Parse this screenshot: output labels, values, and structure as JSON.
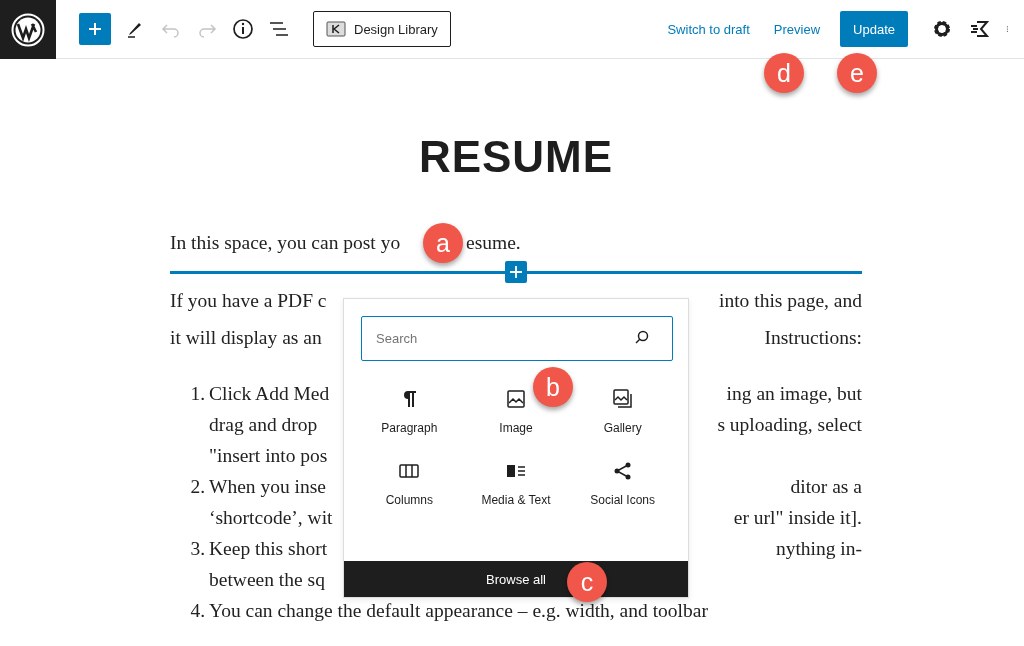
{
  "toolbar": {
    "undo_disabled": true,
    "redo_disabled": true,
    "design_library": "Design Library",
    "switch_to_draft": "Switch to draft",
    "preview": "Preview",
    "update": "Update"
  },
  "title": "RESUME",
  "intro": {
    "left": "In this space, you can post yo",
    "right": "esume."
  },
  "paragraph_lines": [
    {
      "left": "If you have a PDF c",
      "right": "into this page, and"
    },
    {
      "left": "it will display as an",
      "right": "Instructions:"
    }
  ],
  "list": [
    {
      "number": "1.",
      "lines": [
        {
          "left": "Click Add Med",
          "right": "ing an image, but"
        },
        {
          "left": "drag and drop",
          "right": "s uploading, select"
        },
        {
          "left": "\"insert into pos"
        }
      ]
    },
    {
      "number": "2.",
      "lines": [
        {
          "left": "When you inse",
          "right": "ditor as a"
        },
        {
          "left": "‘shortcode’, wit",
          "right": "er url\" inside it]."
        }
      ]
    },
    {
      "number": "3.",
      "lines": [
        {
          "left": "Keep this short",
          "right": "nything in-"
        },
        {
          "left": "between the sq"
        }
      ]
    },
    {
      "number": "4.",
      "lines": [
        {
          "left": "You can change the default appearance – e.g. width, and toolbar"
        }
      ]
    }
  ],
  "inserter": {
    "search": {
      "placeholder": "Search"
    },
    "blocks": [
      {
        "kind": "paragraph",
        "label": "Paragraph"
      },
      {
        "kind": "image",
        "label": "Image"
      },
      {
        "kind": "gallery",
        "label": "Gallery"
      },
      {
        "kind": "columns",
        "label": "Columns"
      },
      {
        "kind": "media-text",
        "label": "Media & Text"
      },
      {
        "kind": "social",
        "label": "Social Icons"
      }
    ],
    "browse_all": "Browse all"
  },
  "callouts": [
    {
      "letter": "a"
    },
    {
      "letter": "b"
    },
    {
      "letter": "c"
    },
    {
      "letter": "d"
    },
    {
      "letter": "e"
    }
  ]
}
